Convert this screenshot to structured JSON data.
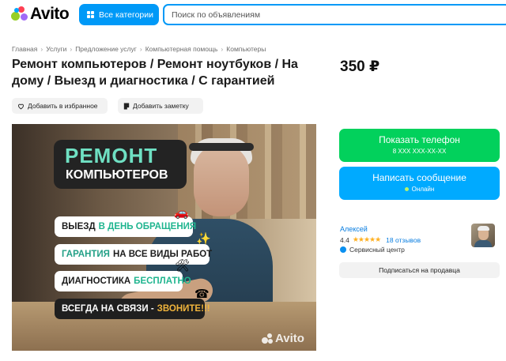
{
  "header": {
    "logo_text": "Avito",
    "categories_button": "Все категории",
    "search_placeholder": "Поиск по объявлениям"
  },
  "breadcrumbs": [
    "Главная",
    "Услуги",
    "Предложение услуг",
    "Компьютерная помощь",
    "Компьютеры"
  ],
  "listing": {
    "title": "Ремонт компьютеров / Ремонт ноутбуков / На дому / Выезд и диагностика / С гарантией",
    "price": "350 ₽",
    "favorite_label": "Добавить в избранное",
    "note_label": "Добавить заметку"
  },
  "image": {
    "headline_1": "РЕМОНТ",
    "headline_2": "КОМПЬЮТЕРОВ",
    "line1_a": "ВЫЕЗД",
    "line1_b": "В ДЕНЬ ОБРАЩЕНИЯ",
    "line2_a": "ГАРАНТИЯ",
    "line2_b": "НА ВСЕ ВИДЫ РАБОТ",
    "line3_a": "ДИАГНОСТИКА",
    "line3_b": "БЕСПЛАТНО",
    "line4_a": "ВСЕГДА НА СВЯЗИ -",
    "line4_b": "ЗВОНИТЕ!!!",
    "watermark": "Avito"
  },
  "contact": {
    "phone_button": "Показать телефон",
    "phone_masked": "8 XXX XXX-XX-XX",
    "message_button": "Написать сообщение",
    "online_status": "Онлайн"
  },
  "seller": {
    "name": "Алексей",
    "rating": "4.4",
    "stars": "★★★★★",
    "reviews": "18 отзывов",
    "type": "Сервисный центр",
    "subscribe_button": "Подписаться на продавца"
  },
  "colors": {
    "accent_blue": "#0099f7",
    "phone_green": "#02d15c",
    "message_blue": "#00aaff"
  }
}
